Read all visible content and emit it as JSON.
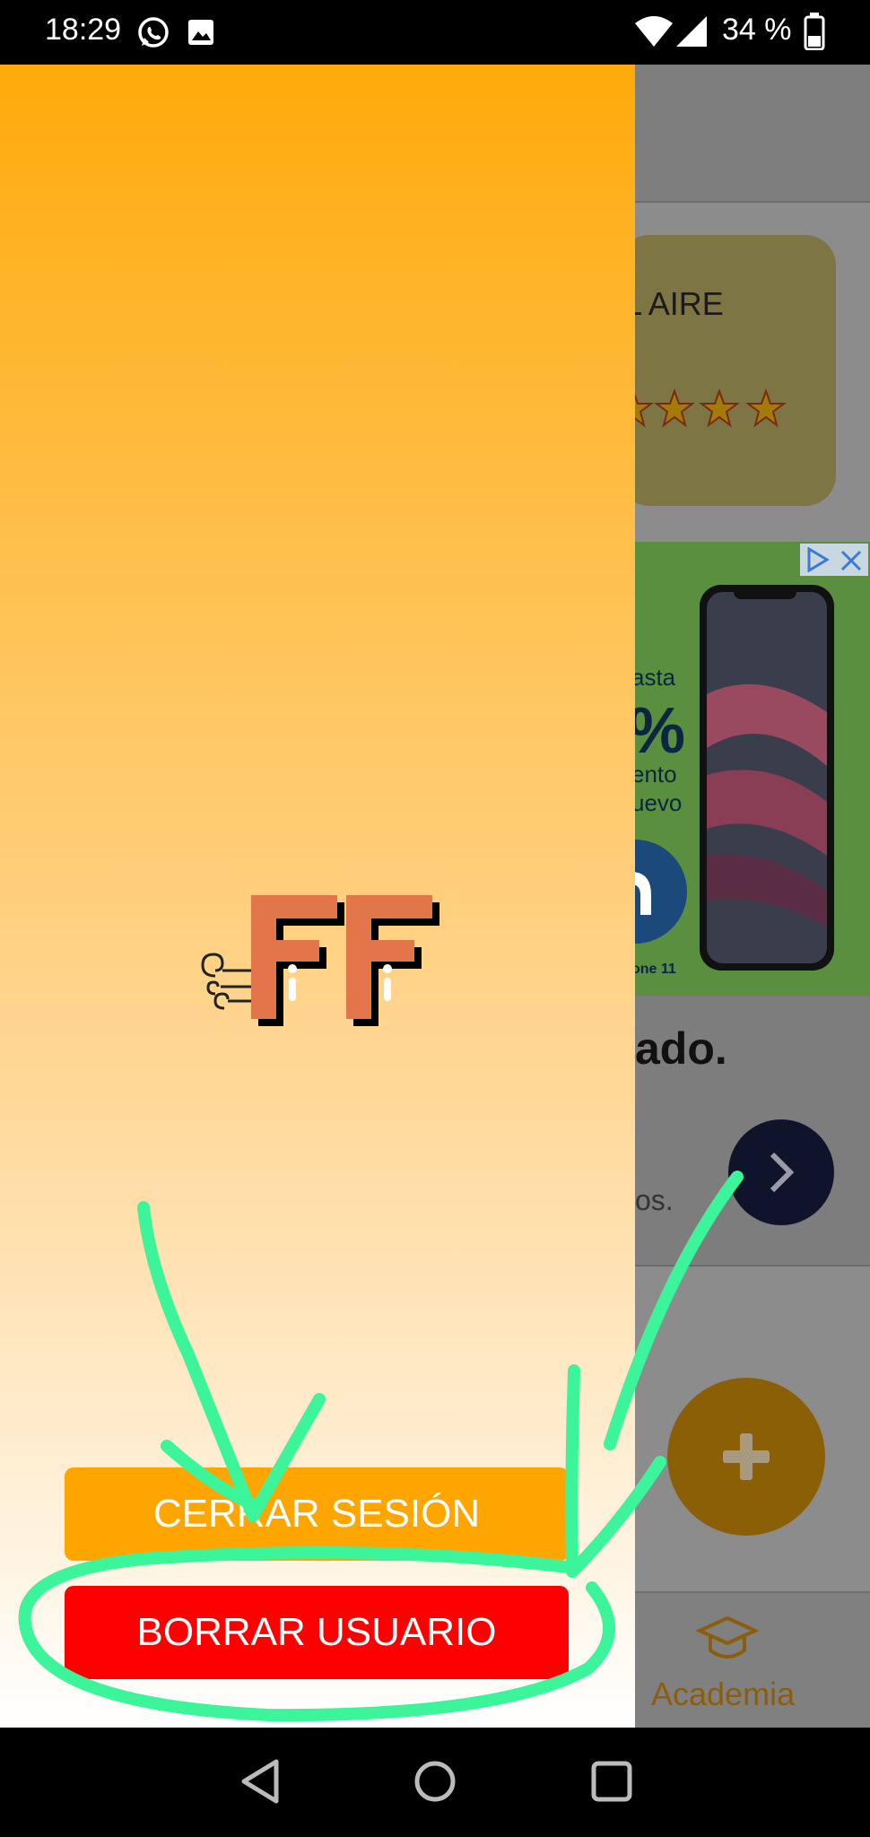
{
  "status_bar": {
    "time": "18:29",
    "battery": "34 %",
    "icons": [
      "whatsapp-icon",
      "gallery-icon",
      "wifi-icon",
      "signal-icon",
      "battery-icon"
    ]
  },
  "background_app": {
    "product_title_fragment": "L AIRE",
    "ad_fragments": [
      "asta",
      "%",
      "ento",
      "uevo",
      "one 11"
    ],
    "headline_fragment": "ado.",
    "subtext_fragment": "os.",
    "bottom_nav_label": "Academia"
  },
  "drawer": {
    "logo_text": "FF",
    "logout_label": "CERRAR SESIÓN",
    "delete_user_label": "BORRAR USUARIO"
  },
  "colors": {
    "drawer_top": "#ffaa0a",
    "logout_button": "#ffa500",
    "delete_button": "#ff0000",
    "annotation": "#3cf59a"
  },
  "nav_bar": {
    "icons": [
      "back-icon",
      "home-icon",
      "recents-icon"
    ]
  }
}
